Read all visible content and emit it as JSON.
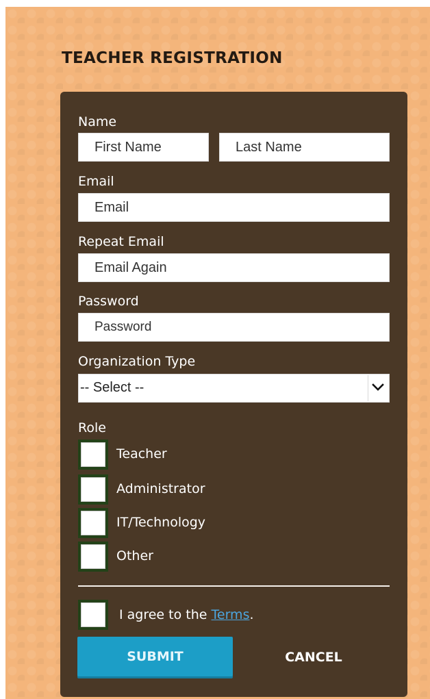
{
  "page": {
    "title": "TEACHER REGISTRATION"
  },
  "form": {
    "name_label": "Name",
    "first_name_placeholder": "First Name",
    "last_name_placeholder": "Last Name",
    "email_label": "Email",
    "email_placeholder": "Email",
    "repeat_email_label": "Repeat Email",
    "repeat_email_placeholder": "Email Again",
    "password_label": "Password",
    "password_placeholder": "Password",
    "org_type_label": "Organization Type",
    "org_type_value": "-- Select --",
    "role_label": "Role",
    "roles": [
      {
        "label": "Teacher",
        "checked": false
      },
      {
        "label": "Administrator",
        "checked": false
      },
      {
        "label": "IT/Technology",
        "checked": false
      },
      {
        "label": "Other",
        "checked": false
      }
    ],
    "terms_prefix": "I agree to the",
    "terms_link": "Terms",
    "terms_suffix": ".",
    "submit_label": "SUBMIT",
    "cancel_label": "CANCEL"
  },
  "icons": {
    "select_arrow": "chevron-down-icon"
  },
  "colors": {
    "page_background": "#f4b57b",
    "panel_background": "#4a3826",
    "submit_button": "#1c9ec7",
    "terms_link": "#4ca6e0"
  }
}
